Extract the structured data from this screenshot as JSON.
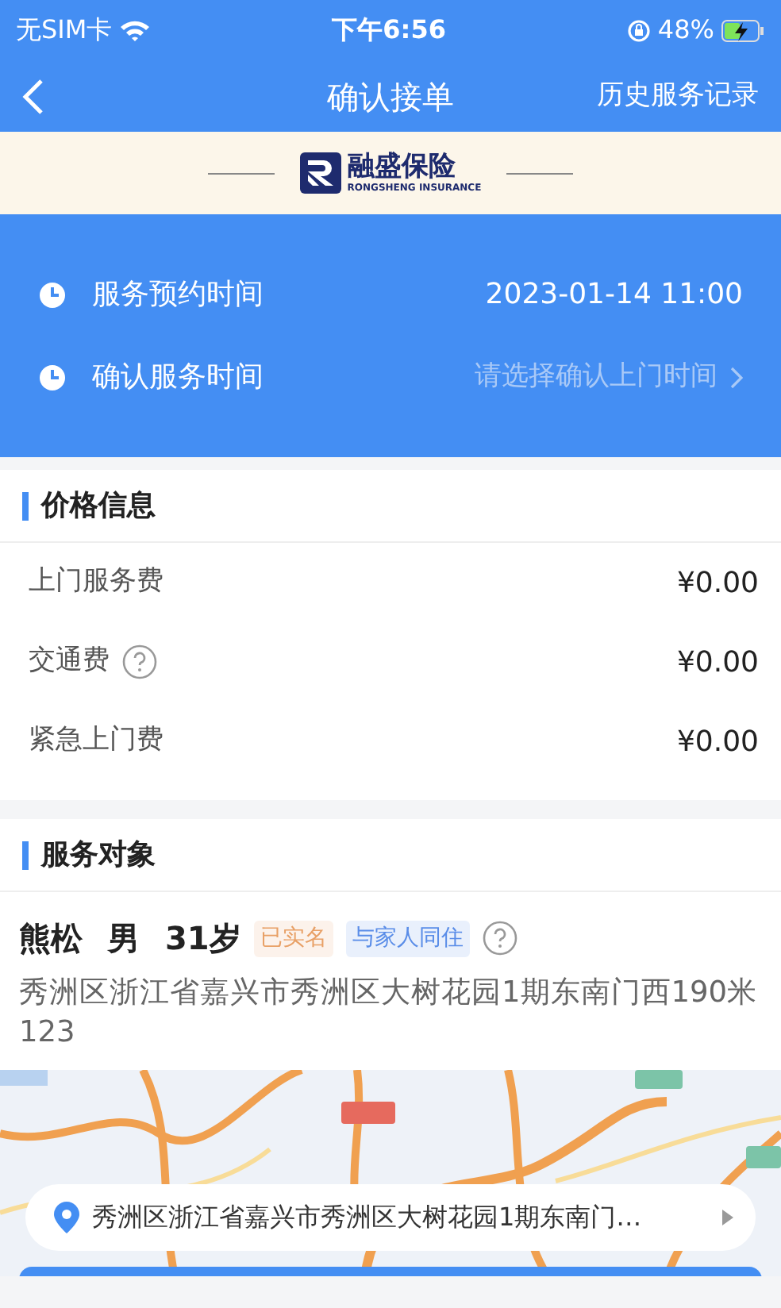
{
  "status_bar": {
    "carrier": "无SIM卡",
    "time": "下午6:56",
    "battery": "48%",
    "charging": true
  },
  "nav": {
    "title": "确认接单",
    "action": "历史服务记录"
  },
  "banner": {
    "brand": "融盛保险",
    "brand_en": "RONGSHENG INSURANCE"
  },
  "schedule": [
    {
      "kind": "value",
      "label": "服务预约时间",
      "value": "2023-01-14 11:00"
    },
    {
      "kind": "picker",
      "label": "确认服务时间",
      "placeholder": "请选择确认上门时间"
    }
  ],
  "price": {
    "title": "价格信息",
    "rows": [
      {
        "label": "上门服务费",
        "value": "¥0.00",
        "help": false
      },
      {
        "label": "交通费",
        "value": "¥0.00",
        "help": true
      },
      {
        "label": "紧急上门费",
        "value": "¥0.00",
        "help": false
      }
    ]
  },
  "service_target": {
    "title": "服务对象",
    "name": "熊松",
    "gender": "男",
    "age": "31岁",
    "tags": [
      {
        "text": "已实名",
        "color": "#e8a066"
      },
      {
        "text": "与家人同住",
        "color": "#5a8de8"
      }
    ],
    "address": "秀洲区浙江省嘉兴市秀洲区大树花园1期东南门西190米123",
    "map": {
      "kind": "picture",
      "address": "秀洲区浙江省嘉兴市秀洲区大树花园1期东南门…"
    }
  }
}
